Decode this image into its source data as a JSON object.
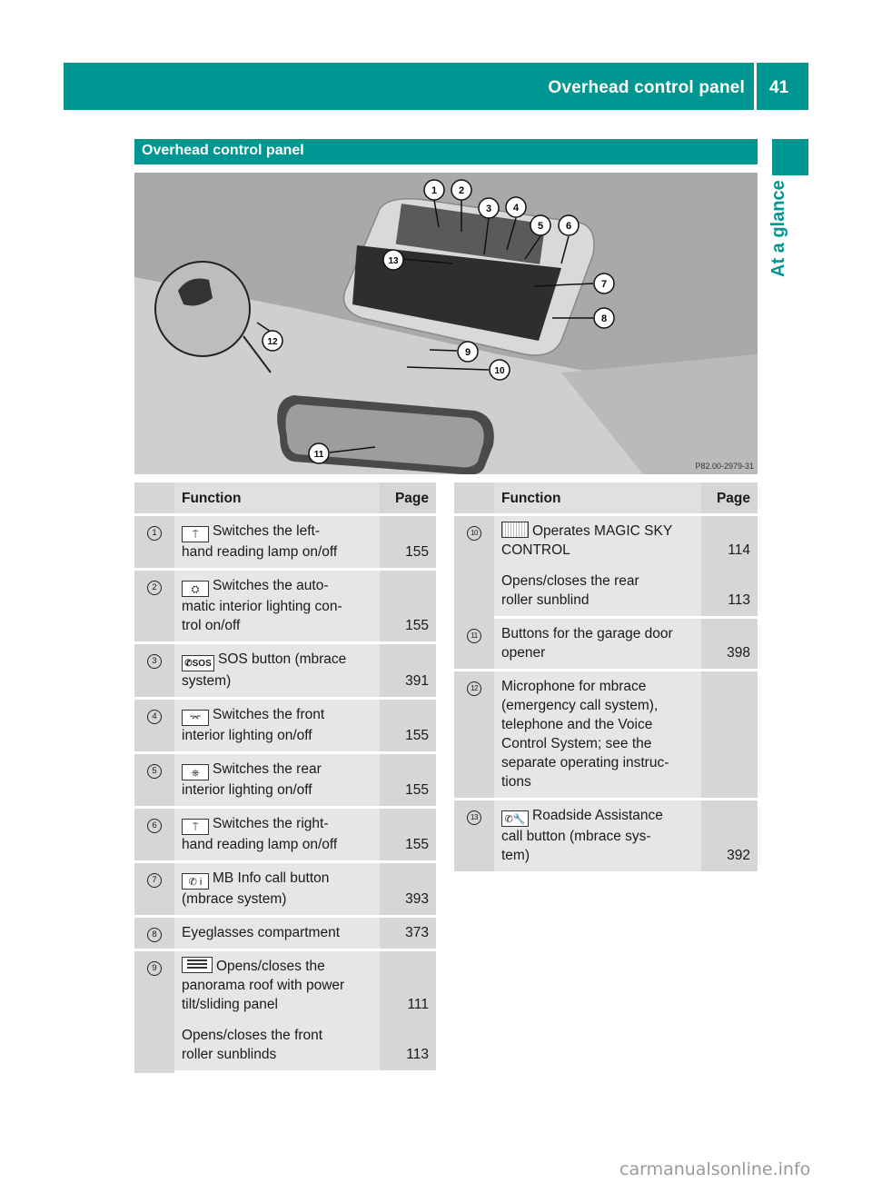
{
  "header": {
    "title": "Overhead control panel",
    "page_number": "41"
  },
  "side_tab": {
    "label": "At a glance"
  },
  "section": {
    "title": "Overhead control panel"
  },
  "figure": {
    "callouts": [
      "1",
      "2",
      "3",
      "4",
      "5",
      "6",
      "7",
      "8",
      "9",
      "10",
      "11",
      "12",
      "13"
    ],
    "code": "P82.00-2979-31"
  },
  "table_headers": {
    "function": "Function",
    "page": "Page"
  },
  "left_table": [
    {
      "num": "1",
      "icon": "reading-lamp-left-icon",
      "icon_glyph": "⍑",
      "lines": [
        "Switches the left-",
        "hand reading lamp on/off"
      ],
      "page": "155"
    },
    {
      "num": "2",
      "icon": "auto-interior-light-icon",
      "icon_glyph": "⛭",
      "lines": [
        "Switches the auto-",
        "matic interior lighting con-",
        "trol on/off"
      ],
      "page": "155"
    },
    {
      "num": "3",
      "icon": "sos-phone-icon",
      "icon_glyph": "✆SOS",
      "lines": [
        "SOS button (mbrace",
        "system)"
      ],
      "page": "391"
    },
    {
      "num": "4",
      "icon": "front-interior-light-icon",
      "icon_glyph": "⌤",
      "lines": [
        "Switches the front",
        "interior lighting on/off"
      ],
      "page": "155"
    },
    {
      "num": "5",
      "icon": "rear-interior-light-icon",
      "icon_glyph": "⎈",
      "lines": [
        "Switches the rear",
        "interior lighting on/off"
      ],
      "page": "155"
    },
    {
      "num": "6",
      "icon": "reading-lamp-right-icon",
      "icon_glyph": "⍑",
      "lines": [
        "Switches the right-",
        "hand reading lamp on/off"
      ],
      "page": "155"
    },
    {
      "num": "7",
      "icon": "info-call-icon",
      "icon_glyph": "✆ i",
      "lines": [
        "MB Info call button",
        "(mbrace system)"
      ],
      "page": "393"
    },
    {
      "num": "8",
      "icon": "",
      "icon_glyph": "",
      "lines": [
        "Eyeglasses compartment"
      ],
      "page": "373"
    },
    {
      "num": "9",
      "icon": "panorama-roof-icon",
      "icon_glyph": "",
      "lines": [
        "Opens/closes the",
        "panorama roof with power",
        "tilt/sliding panel"
      ],
      "page": "111",
      "extra": {
        "lines": [
          "Opens/closes the front",
          "roller sunblinds"
        ],
        "page": "113"
      }
    }
  ],
  "right_table": [
    {
      "num": "10",
      "icon": "magic-sky-icon",
      "icon_glyph": "",
      "lines": [
        "Operates MAGIC SKY",
        "CONTROL"
      ],
      "page": "114",
      "extra": {
        "lines": [
          "Opens/closes the rear",
          "roller sunblind"
        ],
        "page": "113"
      }
    },
    {
      "num": "11",
      "icon": "",
      "icon_glyph": "",
      "lines": [
        "Buttons for the garage door",
        "opener"
      ],
      "page": "398"
    },
    {
      "num": "12",
      "icon": "",
      "icon_glyph": "",
      "lines": [
        "Microphone for mbrace",
        "(emergency call system),",
        "telephone and the Voice",
        "Control System; see the",
        "separate operating instruc-",
        "tions"
      ],
      "page": ""
    },
    {
      "num": "13",
      "icon": "roadside-assistance-icon",
      "icon_glyph": "✆🔧",
      "lines": [
        "Roadside Assistance",
        "call button (mbrace sys-",
        "tem)"
      ],
      "page": "392"
    }
  ],
  "watermark": "carmanualsonline.info"
}
